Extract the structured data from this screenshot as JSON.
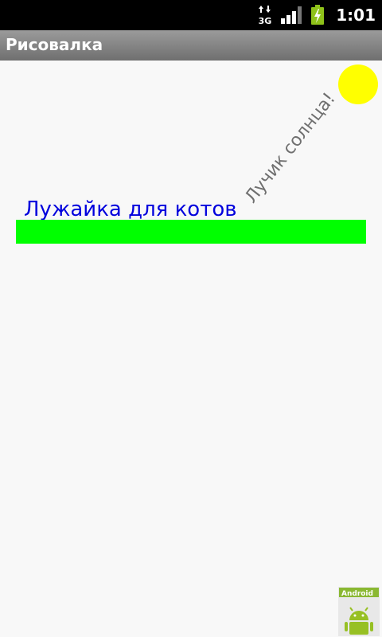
{
  "status_bar": {
    "network_type": "3G",
    "time": "1:01",
    "icons": [
      "data-transfer-icon",
      "signal-strength-icon",
      "battery-charging-icon"
    ]
  },
  "app": {
    "title": "Рисовалка"
  },
  "canvas": {
    "sun_caption": "Лучик солнца!",
    "lawn_label": "Лужайка для котов",
    "colors": {
      "sun": "#ffff00",
      "lawn": "#00ff00",
      "lawn_label": "#0000dd",
      "sun_caption": "#6f6f6f",
      "background": "#f8f8f8"
    }
  },
  "watermark": {
    "label": "Android"
  }
}
